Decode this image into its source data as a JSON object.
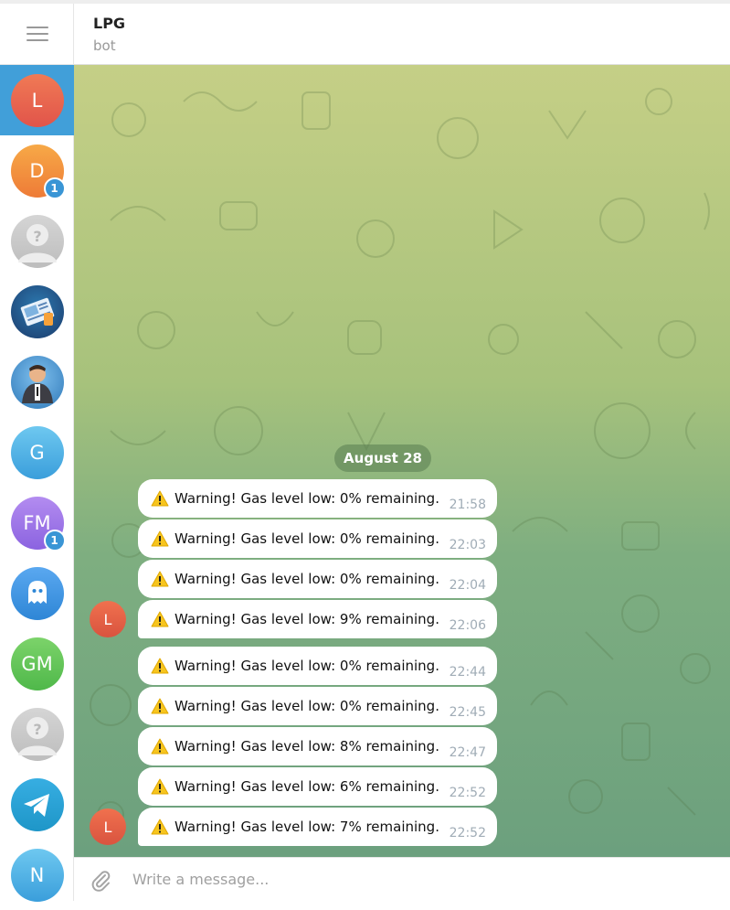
{
  "header": {
    "title": "LPG",
    "subtitle": "bot"
  },
  "sidebar": {
    "chats": [
      {
        "initials": "L",
        "icon": "avatar-letter",
        "color_top": "#f07a55",
        "color_bottom": "#e1544a",
        "badge": null,
        "active": true
      },
      {
        "initials": "D",
        "icon": "avatar-letter",
        "color_top": "#f7a947",
        "color_bottom": "#ee7b37",
        "badge": "1",
        "active": false
      },
      {
        "initials": "",
        "icon": "unknown-user-avatar-icon",
        "color_top": "#d5d5d5",
        "color_bottom": "#bdbdbd",
        "badge": null,
        "active": false
      },
      {
        "initials": "",
        "icon": "map-document-avatar-icon",
        "color_top": "#1c3b6b",
        "color_bottom": "#2c79b0",
        "badge": null,
        "active": false
      },
      {
        "initials": "",
        "icon": "cartoon-person-avatar-icon",
        "color_top": "#3a86c8",
        "color_bottom": "#1d5e9a",
        "badge": null,
        "active": false
      },
      {
        "initials": "G",
        "icon": "avatar-letter",
        "color_top": "#6ec8f0",
        "color_bottom": "#3a9edb",
        "badge": null,
        "active": false
      },
      {
        "initials": "FM",
        "icon": "avatar-letter",
        "color_top": "#b38cf0",
        "color_bottom": "#8b63e0",
        "badge": "1",
        "active": false
      },
      {
        "initials": "",
        "icon": "ghost-avatar-icon",
        "color_top": "#5aa8f0",
        "color_bottom": "#2e86d6",
        "badge": null,
        "active": false
      },
      {
        "initials": "GM",
        "icon": "avatar-letter",
        "color_top": "#7cd36a",
        "color_bottom": "#4fb84a",
        "badge": null,
        "active": false
      },
      {
        "initials": "",
        "icon": "unknown-user-avatar-icon",
        "color_top": "#d5d5d5",
        "color_bottom": "#bdbdbd",
        "badge": null,
        "active": false
      },
      {
        "initials": "",
        "icon": "telegram-plane-avatar-icon",
        "color_top": "#37aee2",
        "color_bottom": "#1e96c8",
        "badge": null,
        "active": false
      },
      {
        "initials": "N",
        "icon": "avatar-letter",
        "color_top": "#6ec8f0",
        "color_bottom": "#3a9edb",
        "badge": null,
        "active": false
      }
    ]
  },
  "chat": {
    "date_label": "August 28",
    "sender_initial": "L",
    "messages": [
      {
        "text": "Warning! Gas level low: 0% remaining.",
        "time": "21:58"
      },
      {
        "text": "Warning! Gas level low: 0% remaining.",
        "time": "22:03"
      },
      {
        "text": "Warning! Gas level low: 0% remaining.",
        "time": "22:04"
      },
      {
        "text": "Warning! Gas level low: 9% remaining.",
        "time": "22:06"
      },
      {
        "text": "Warning! Gas level low: 0% remaining.",
        "time": "22:44"
      },
      {
        "text": "Warning! Gas level low: 0% remaining.",
        "time": "22:45"
      },
      {
        "text": "Warning! Gas level low: 8% remaining.",
        "time": "22:47"
      },
      {
        "text": "Warning! Gas level low: 6% remaining.",
        "time": "22:52"
      },
      {
        "text": "Warning! Gas level low: 7% remaining.",
        "time": "22:52"
      }
    ]
  },
  "composer": {
    "placeholder": "Write a message..."
  },
  "colors": {
    "accent": "#419fd9",
    "warning": "#f7c51e"
  }
}
